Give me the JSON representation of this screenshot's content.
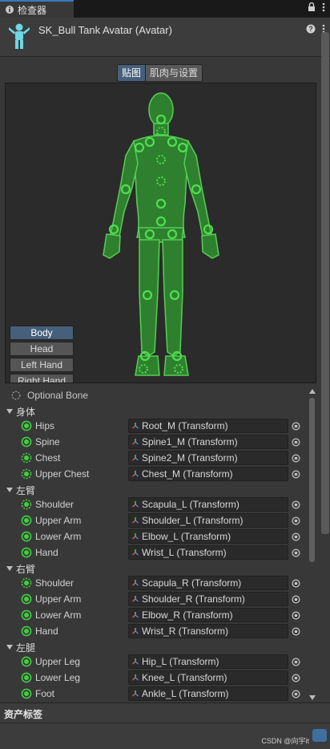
{
  "window": {
    "tab_label": "检查器",
    "tab_icon": "info-icon",
    "lock_icon": "lock-icon",
    "menu_icon": "kebab-menu-icon"
  },
  "header": {
    "title": "SK_Bull Tank Avatar (Avatar)",
    "icon": "avatar-figure-icon",
    "help_icon": "help-icon",
    "menu_icon": "kebab-menu-icon"
  },
  "mode_tabs": [
    {
      "label": "贴图",
      "active": true
    },
    {
      "label": "肌肉与设置",
      "active": false
    }
  ],
  "body_parts": [
    {
      "label": "Body",
      "active": true
    },
    {
      "label": "Head",
      "active": false
    },
    {
      "label": "Left Hand",
      "active": false
    },
    {
      "label": "Right Hand",
      "active": false
    }
  ],
  "legend": {
    "label": "Optional Bone",
    "icon": "dashed-circle-icon"
  },
  "groups": [
    {
      "label": "身体",
      "bones": [
        {
          "name": "Hips",
          "value": "Root_M (Transform)",
          "optional": false
        },
        {
          "name": "Spine",
          "value": "Spine1_M (Transform)",
          "optional": false
        },
        {
          "name": "Chest",
          "value": "Spine2_M (Transform)",
          "optional": true
        },
        {
          "name": "Upper Chest",
          "value": "Chest_M (Transform)",
          "optional": true
        }
      ]
    },
    {
      "label": "左臂",
      "bones": [
        {
          "name": "Shoulder",
          "value": "Scapula_L (Transform)",
          "optional": true
        },
        {
          "name": "Upper Arm",
          "value": "Shoulder_L (Transform)",
          "optional": false
        },
        {
          "name": "Lower Arm",
          "value": "Elbow_L (Transform)",
          "optional": false
        },
        {
          "name": "Hand",
          "value": "Wrist_L (Transform)",
          "optional": false
        }
      ]
    },
    {
      "label": "右臂",
      "bones": [
        {
          "name": "Shoulder",
          "value": "Scapula_R (Transform)",
          "optional": true
        },
        {
          "name": "Upper Arm",
          "value": "Shoulder_R (Transform)",
          "optional": false
        },
        {
          "name": "Lower Arm",
          "value": "Elbow_R (Transform)",
          "optional": false
        },
        {
          "name": "Hand",
          "value": "Wrist_R (Transform)",
          "optional": false
        }
      ]
    },
    {
      "label": "左腿",
      "bones": [
        {
          "name": "Upper Leg",
          "value": "Hip_L (Transform)",
          "optional": false
        },
        {
          "name": "Lower Leg",
          "value": "Knee_L (Transform)",
          "optional": false
        },
        {
          "name": "Foot",
          "value": "Ankle_L (Transform)",
          "optional": false
        }
      ]
    }
  ],
  "footer": {
    "title": "资产标签"
  },
  "watermark": "CSDN @向宇it",
  "colors": {
    "bone_green": "#3fd03f",
    "figure_fill": "#2f8a2f",
    "accent": "#46607c"
  }
}
